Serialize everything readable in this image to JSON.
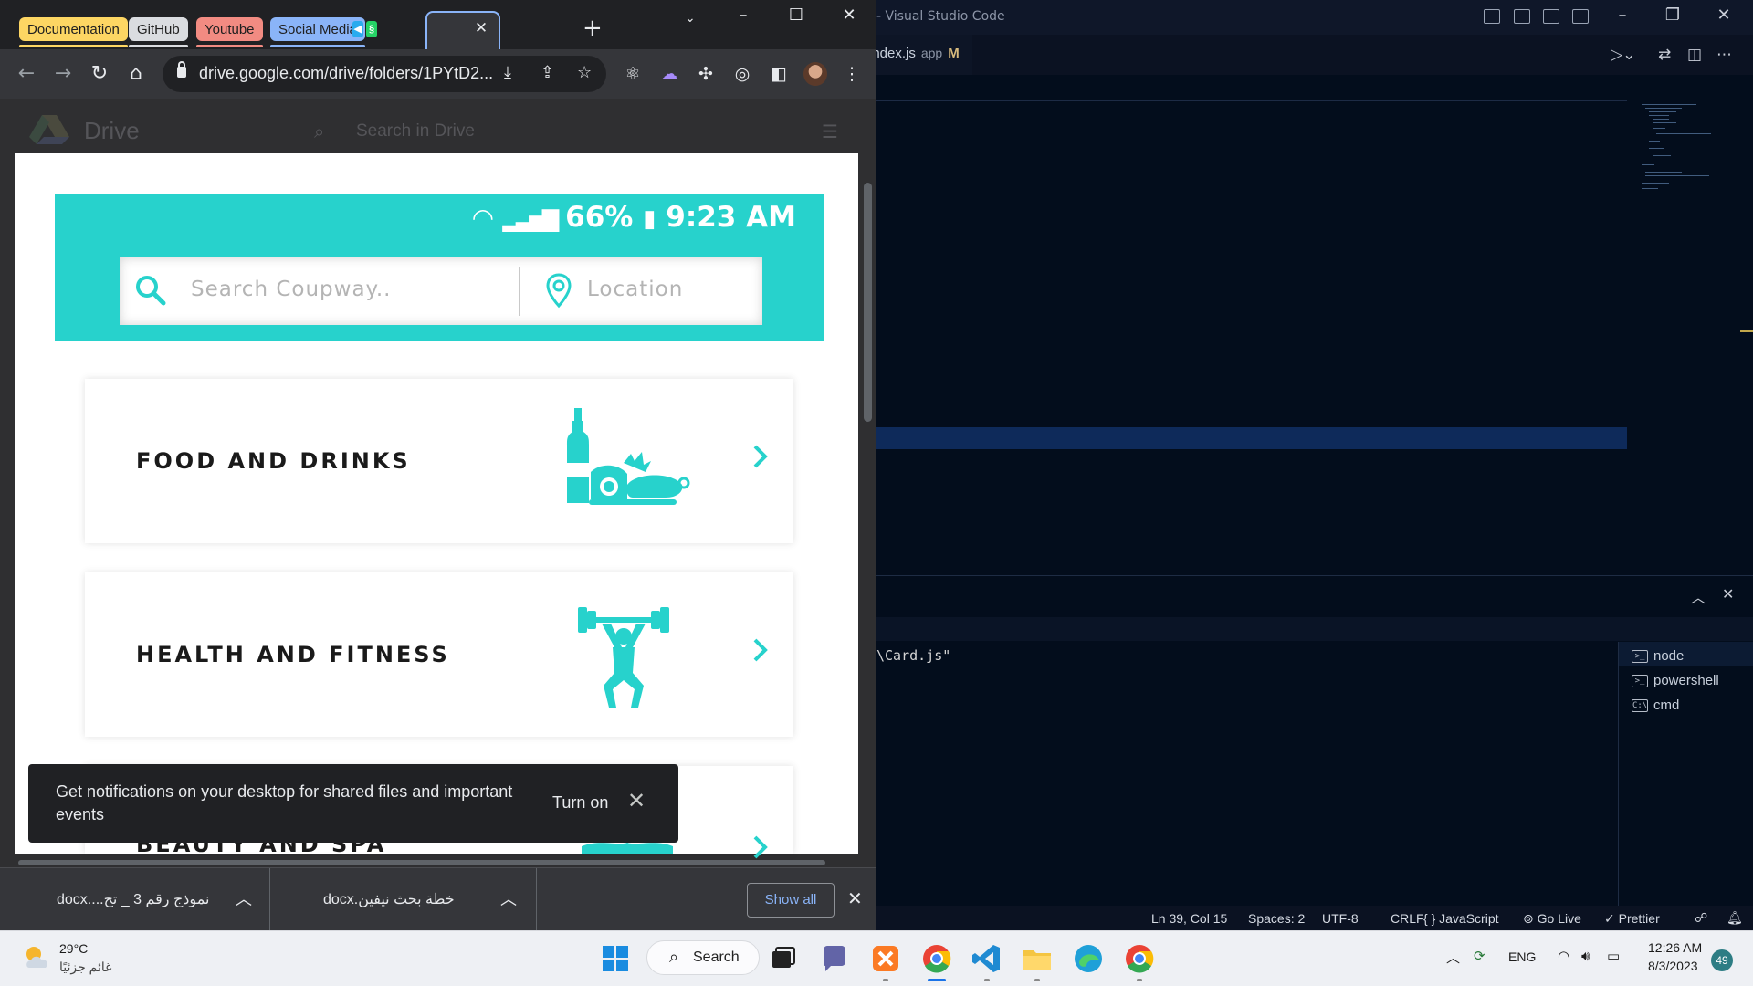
{
  "vscode": {
    "title": "- Visual Studio Code",
    "tab": {
      "filename": "index.js",
      "path": "app",
      "status": "M"
    },
    "terminal_output": "\\Card.js\"",
    "terminals": [
      {
        "label": "node",
        "icon": "terminal-icon"
      },
      {
        "label": "powershell",
        "icon": "terminal-icon"
      },
      {
        "label": "cmd",
        "icon": "cmd-icon"
      }
    ],
    "status": {
      "position": "Ln 39, Col 15",
      "spaces": "Spaces: 2",
      "encoding": "UTF-8",
      "eol": "CRLF",
      "language": "{ } JavaScript",
      "golive": "Go Live",
      "prettier": "✓ Prettier"
    }
  },
  "chrome": {
    "tab_groups": [
      {
        "label": "Documentation",
        "color": "#fdd663"
      },
      {
        "label": "GitHub",
        "color": "#dadce0"
      },
      {
        "label": "Youtube",
        "color": "#f28b82"
      },
      {
        "label": "Social Media",
        "color": "#8ab4f8"
      }
    ],
    "url": "drive.google.com/drive/folders/1PYtD2...",
    "drive": {
      "name": "Drive",
      "search_placeholder": "Search in Drive"
    }
  },
  "preview": {
    "status_bar": "66% 9:23 AM",
    "battery": "66%",
    "time": "9:23 AM",
    "search_placeholder": "Search Coupway..",
    "location_placeholder": "Location",
    "categories": [
      {
        "label": "FOOD AND DRINKS",
        "icon": "food-drink-icon"
      },
      {
        "label": "HEALTH AND FITNESS",
        "icon": "weightlifter-icon"
      },
      {
        "label": "BEAUTY AND SPA",
        "icon": "spa-icon"
      }
    ],
    "accent_color": "#27d2cc"
  },
  "toast": {
    "message": "Get notifications on your desktop for shared files and important events",
    "action": "Turn on"
  },
  "downloads": {
    "items": [
      {
        "name": "نموذج رقم 3 _ تح....docx"
      },
      {
        "name": "خطة بحث نيفين.docx"
      }
    ],
    "show_all": "Show all"
  },
  "taskbar": {
    "weather_temp": "29°C",
    "weather_desc": "غائم جزئيًا",
    "search": "Search",
    "language": "ENG",
    "time": "12:26 AM",
    "date": "8/3/2023",
    "notifications": "49"
  }
}
